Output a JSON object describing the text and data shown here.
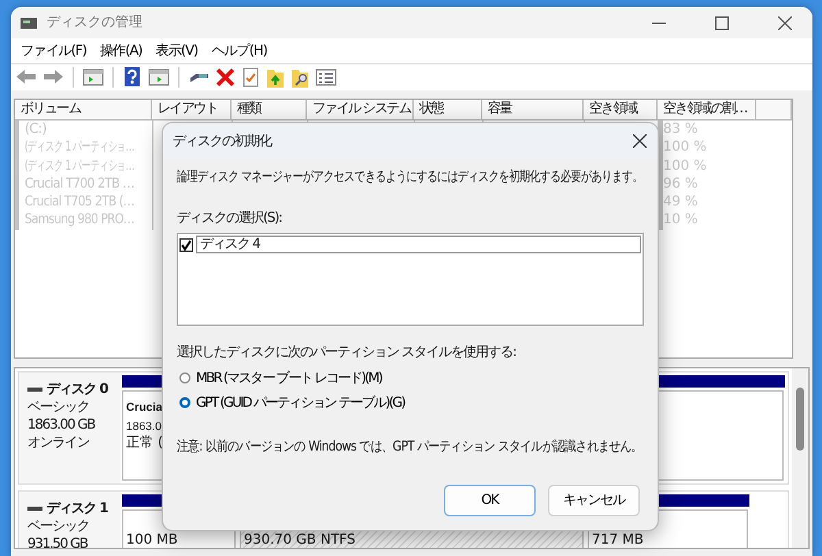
{
  "window": {
    "title": "ディスクの管理"
  },
  "menu": [
    "ファイル(F)",
    "操作(A)",
    "表示(V)",
    "ヘルプ(H)"
  ],
  "volume_table": {
    "columns": [
      "ボリューム",
      "レイアウト",
      "種類",
      "ファイル システム",
      "状態",
      "容量",
      "空き領域",
      "空き領域の割…"
    ],
    "rows": [
      {
        "volume": "(C:)",
        "free_percent": "83 %"
      },
      {
        "volume": "(ディスク 1 パーティショ…",
        "free_percent": "100 %"
      },
      {
        "volume": "(ディスク 1 パーティショ…",
        "free_percent": "100 %"
      },
      {
        "volume": "Crucial T700 2TB …",
        "free_percent": "96 %"
      },
      {
        "volume": "Crucial T705 2TB (…",
        "free_percent": "49 %"
      },
      {
        "volume": "Samsung 980 PRO…",
        "free_percent": "10 %"
      }
    ]
  },
  "disks": [
    {
      "name": "ディスク 0",
      "lines": [
        "ベーシック",
        "1863.00 GB",
        "オンライン"
      ],
      "partitions": [
        {
          "lines": [
            "Crucia",
            "1863.0",
            "正常 ("
          ],
          "selected": false
        }
      ]
    },
    {
      "name": "ディスク 1",
      "lines": [
        "ベーシック",
        "931.50 GB"
      ],
      "partitions": [
        {
          "lines": [
            "100 MB"
          ],
          "selected": false
        },
        {
          "lines": [
            "930.70 GB NTFS"
          ],
          "selected": true
        },
        {
          "lines": [
            "717 MB"
          ],
          "selected": false
        }
      ]
    }
  ],
  "dialog": {
    "title": "ディスクの初期化",
    "message": "論理ディスク マネージャーがアクセスできるようにするにはディスクを初期化する必要があります。",
    "disk_label": "ディスクの選択(S):",
    "disk_list": [
      {
        "label": "ディスク 4",
        "checked": true
      }
    ],
    "style_label": "選択したディスクに次のパーティション スタイルを使用する:",
    "styles": [
      {
        "label": "MBR (マスター ブート レコード)(M)",
        "selected": false
      },
      {
        "label": "GPT (GUID パーティション テーブル)(G)",
        "selected": true
      }
    ],
    "note": "注意: 以前のバージョンの Windows では、GPT パーティション スタイルが認識されません。",
    "buttons": [
      {
        "label": "OK",
        "default": true
      },
      {
        "label": "キャンセル",
        "default": false
      }
    ]
  }
}
